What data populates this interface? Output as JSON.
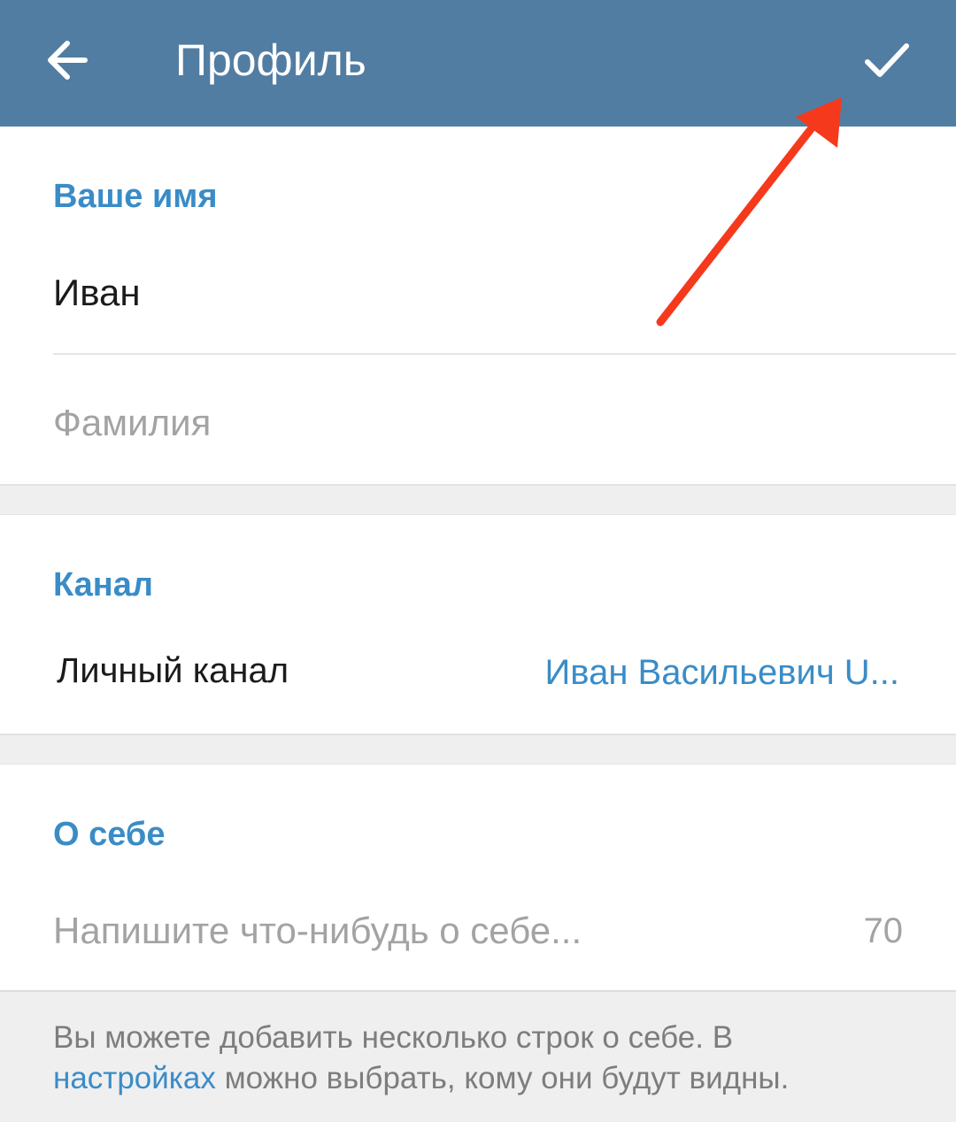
{
  "appbar": {
    "title": "Профиль",
    "back_icon": "arrow-left-icon",
    "done_icon": "checkmark-icon",
    "background_color": "#527da3"
  },
  "name_section": {
    "header": "Ваше имя",
    "first_name_value": "Иван",
    "last_name_placeholder": "Фамилия"
  },
  "channel_section": {
    "header": "Канал",
    "row_label": "Личный канал",
    "row_value": "Иван Васильевич U..."
  },
  "about_section": {
    "header": "О себе",
    "bio_placeholder": "Напишите что-нибудь о себе...",
    "char_counter": "70"
  },
  "hint": {
    "text_before": "Вы можете добавить несколько строк о себе. В ",
    "link_text": "настройках",
    "text_after": " можно выбрать, кому они будут видны."
  },
  "colors": {
    "accent": "#3a8cc7",
    "annotation_arrow": "#f5391c"
  }
}
